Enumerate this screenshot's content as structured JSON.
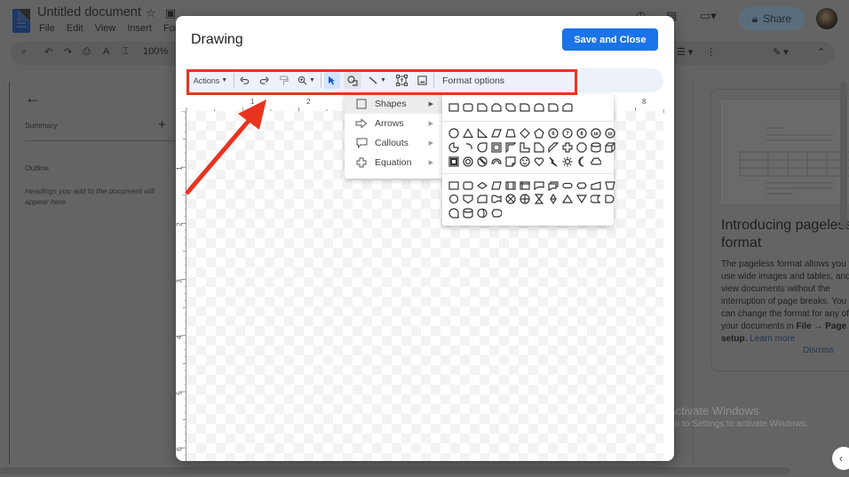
{
  "docs": {
    "title": "Untitled document",
    "menu": [
      "File",
      "Edit",
      "View",
      "Insert",
      "Format"
    ],
    "zoom": "100%",
    "share_label": "Share",
    "summary_label": "Summary",
    "outline_label": "Outline",
    "outline_hint": "Headings you add to the document will appear here.",
    "promo": {
      "title": "Introducing pageless format",
      "body": "The pageless format allows you to use wide images and tables, and view documents without the interruption of page breaks. You can change the format for any of your documents in",
      "menu_path": "File → Page setup",
      "learn_more": "Learn more",
      "dismiss": "Dismiss"
    }
  },
  "dialog": {
    "title": "Drawing",
    "save_label": "Save and Close",
    "toolbar": {
      "actions_label": "Actions",
      "format_options_label": "Format options",
      "icons": [
        "undo-icon",
        "redo-icon",
        "paint-format-icon",
        "zoom-icon",
        "select-icon",
        "shape-icon",
        "line-icon",
        "text-box-icon",
        "image-icon"
      ]
    },
    "ruler": {
      "horizontal": [
        "1",
        "2",
        "8"
      ],
      "vertical": [
        "1",
        "2",
        "3",
        "4",
        "5",
        "6"
      ]
    },
    "shape_menu": {
      "items": [
        {
          "label": "Shapes",
          "icon": "square-icon",
          "selected": true
        },
        {
          "label": "Arrows",
          "icon": "arrow-icon",
          "selected": false
        },
        {
          "label": "Callouts",
          "icon": "callout-icon",
          "selected": false
        },
        {
          "label": "Equation",
          "icon": "equation-icon",
          "selected": false
        }
      ]
    },
    "shapes_submenu": {
      "groups": [
        {
          "rows": [
            [
              "rectangle",
              "rounded-rectangle",
              "snip-single-corner",
              "snip-same-side",
              "snip-diagonal",
              "round-single-corner",
              "round-same-side",
              "round-diagonal",
              "snip-round"
            ]
          ]
        },
        {
          "rows": [
            [
              "ellipse",
              "triangle",
              "right-triangle",
              "parallelogram",
              "trapezoid",
              "diamond",
              "pentagon",
              "hexagon-6",
              "heptagon-7",
              "octagon-8",
              "decagon-10",
              "dodecagon-12"
            ],
            [
              "pie",
              "chord",
              "teardrop",
              "frame-shape",
              "half-frame",
              "l-shape",
              "corner",
              "diagonal-stripe",
              "plus",
              "octagon",
              "can",
              "cube"
            ],
            [
              "bevel",
              "donut",
              "no-symbol",
              "block-arc",
              "folded-corner",
              "smiley",
              "heart",
              "lightning",
              "sun",
              "moon",
              "cloud"
            ]
          ]
        },
        {
          "rows": [
            [
              "process",
              "alternate-process",
              "decision",
              "data",
              "predefined-process",
              "internal-storage",
              "document",
              "multi-document",
              "terminator",
              "preparation",
              "manual-input",
              "manual-operation"
            ],
            [
              "connector",
              "off-page-connector",
              "card",
              "punched-tape",
              "summing-junction",
              "or",
              "collate",
              "sort",
              "extract",
              "merge",
              "stored-data",
              "delay"
            ],
            [
              "sequential-access",
              "magnetic-disk",
              "direct-access",
              "display"
            ]
          ]
        }
      ]
    }
  },
  "watermark": {
    "line1": "Activate Windows",
    "line2": "Go to Settings to activate Windows."
  },
  "colors": {
    "accent": "#1a73e8",
    "annotation": "#e8341f",
    "overlay": "#646464"
  }
}
